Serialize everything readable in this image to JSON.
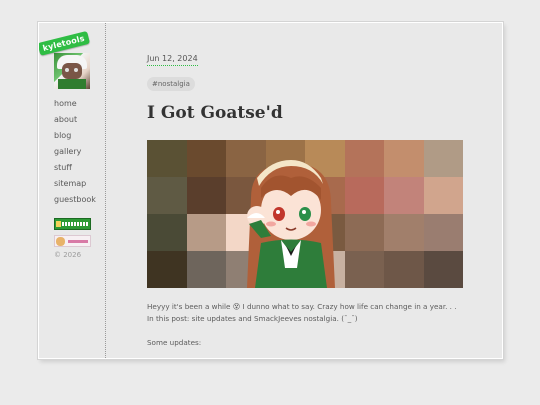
{
  "sidebar": {
    "badge": "kyletools",
    "nav": [
      "home",
      "about",
      "blog",
      "gallery",
      "stuff",
      "sitemap",
      "guestbook"
    ],
    "copyright": "© 2026"
  },
  "post": {
    "date": "Jun 12, 2024",
    "tag": "#nostalgia",
    "title": "I Got Goatse'd",
    "intro_line1": "Heyyy it's been a while 😵 I dunno what to say. Crazy how life can change in a year. . .",
    "intro_line2": "In this post: site updates and SmackJeeves nostalgia. (¯_¯)",
    "updates_label": "Some updates:",
    "hero_palette": [
      "#5a5134",
      "#6a4a2e",
      "#8a6443",
      "#9c7248",
      "#b88a58",
      "#b4735a",
      "#c38e6d",
      "#b09b86",
      "#5f5a44",
      "#5a3e2c",
      "#7a573e",
      "#a7744b",
      "#a86a4d",
      "#b86a5c",
      "#c2837a",
      "#d1a58d",
      "#4a4a36",
      "#b79b87",
      "#f3d7c7",
      "#d9a18c",
      "#7a5a40",
      "#8d6b55",
      "#a17f6b",
      "#9a7d70",
      "#3f3422",
      "#6e655c",
      "#8f7f73",
      "#b4a294",
      "#c8b1a1",
      "#7a6150",
      "#6e5748",
      "#5a4a40"
    ]
  },
  "colors": {
    "accent": "#2fbd44",
    "background": "#e9e9e9",
    "text": "#5c5c5c"
  }
}
